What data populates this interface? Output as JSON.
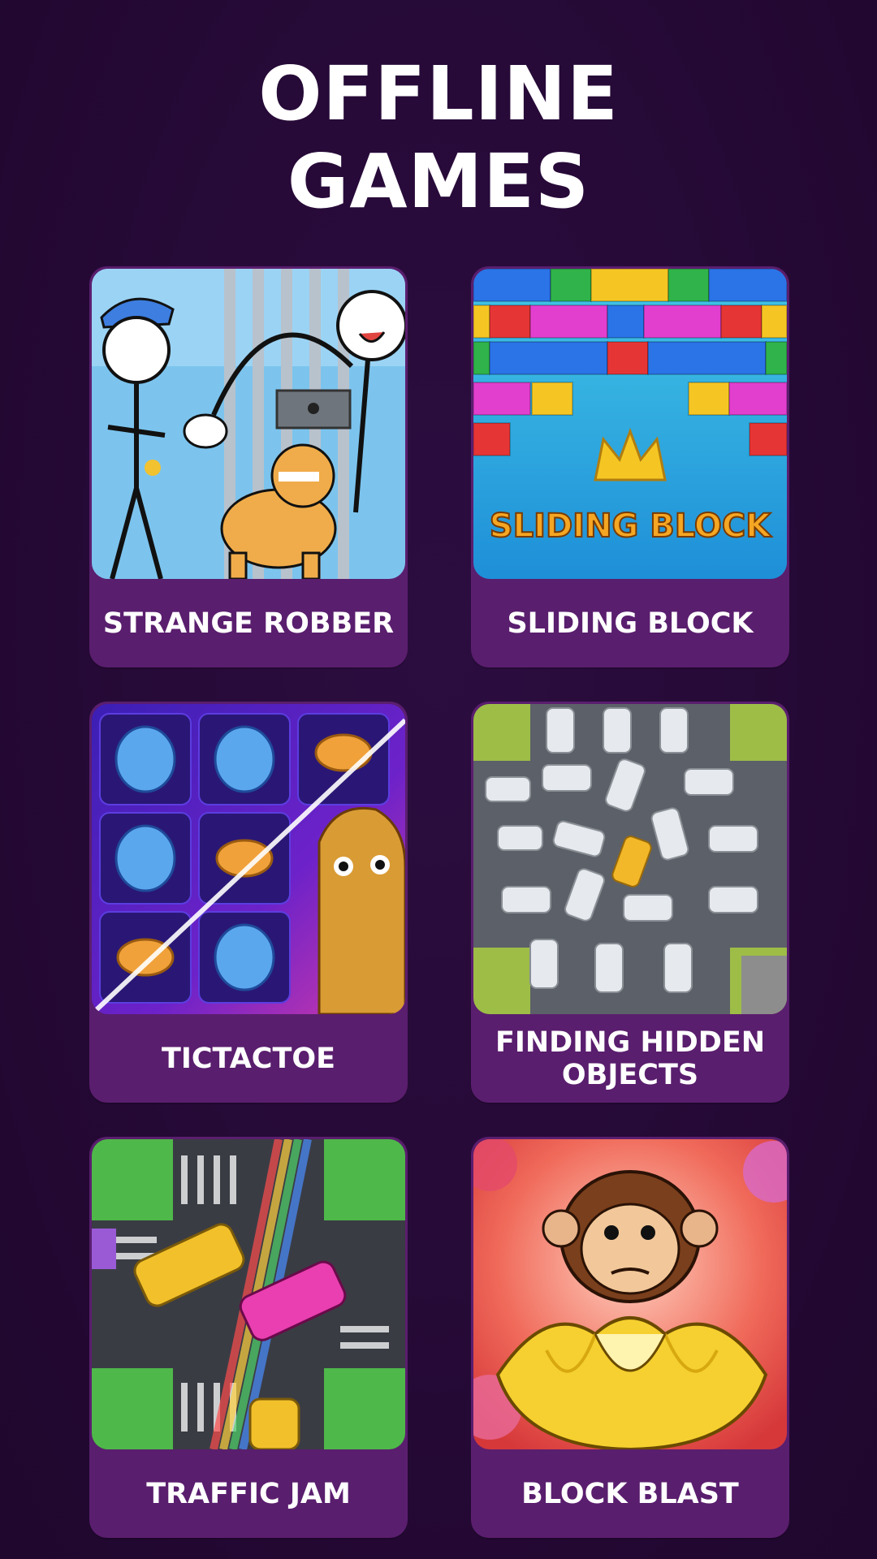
{
  "header": {
    "title_line1": "OFFLINE",
    "title_line2": "GAMES"
  },
  "games": [
    {
      "label": "STRANGE ROBBER",
      "icon": "stickman-jail-icon"
    },
    {
      "label": "SLIDING BLOCK",
      "icon": "sliding-block-icon",
      "art_text": "SLIDING BLOCK"
    },
    {
      "label": "TICTACTOE",
      "icon": "tictactoe-shark-icon"
    },
    {
      "label": "FINDING HIDDEN OBJECTS",
      "icon": "parking-cars-icon"
    },
    {
      "label": "TRAFFIC JAM",
      "icon": "traffic-jam-icon"
    },
    {
      "label": "BLOCK BLAST",
      "icon": "monkey-banana-icon"
    }
  ],
  "colors": {
    "background": "#270a38",
    "card": "#5a1e6e",
    "text": "#ffffff"
  }
}
